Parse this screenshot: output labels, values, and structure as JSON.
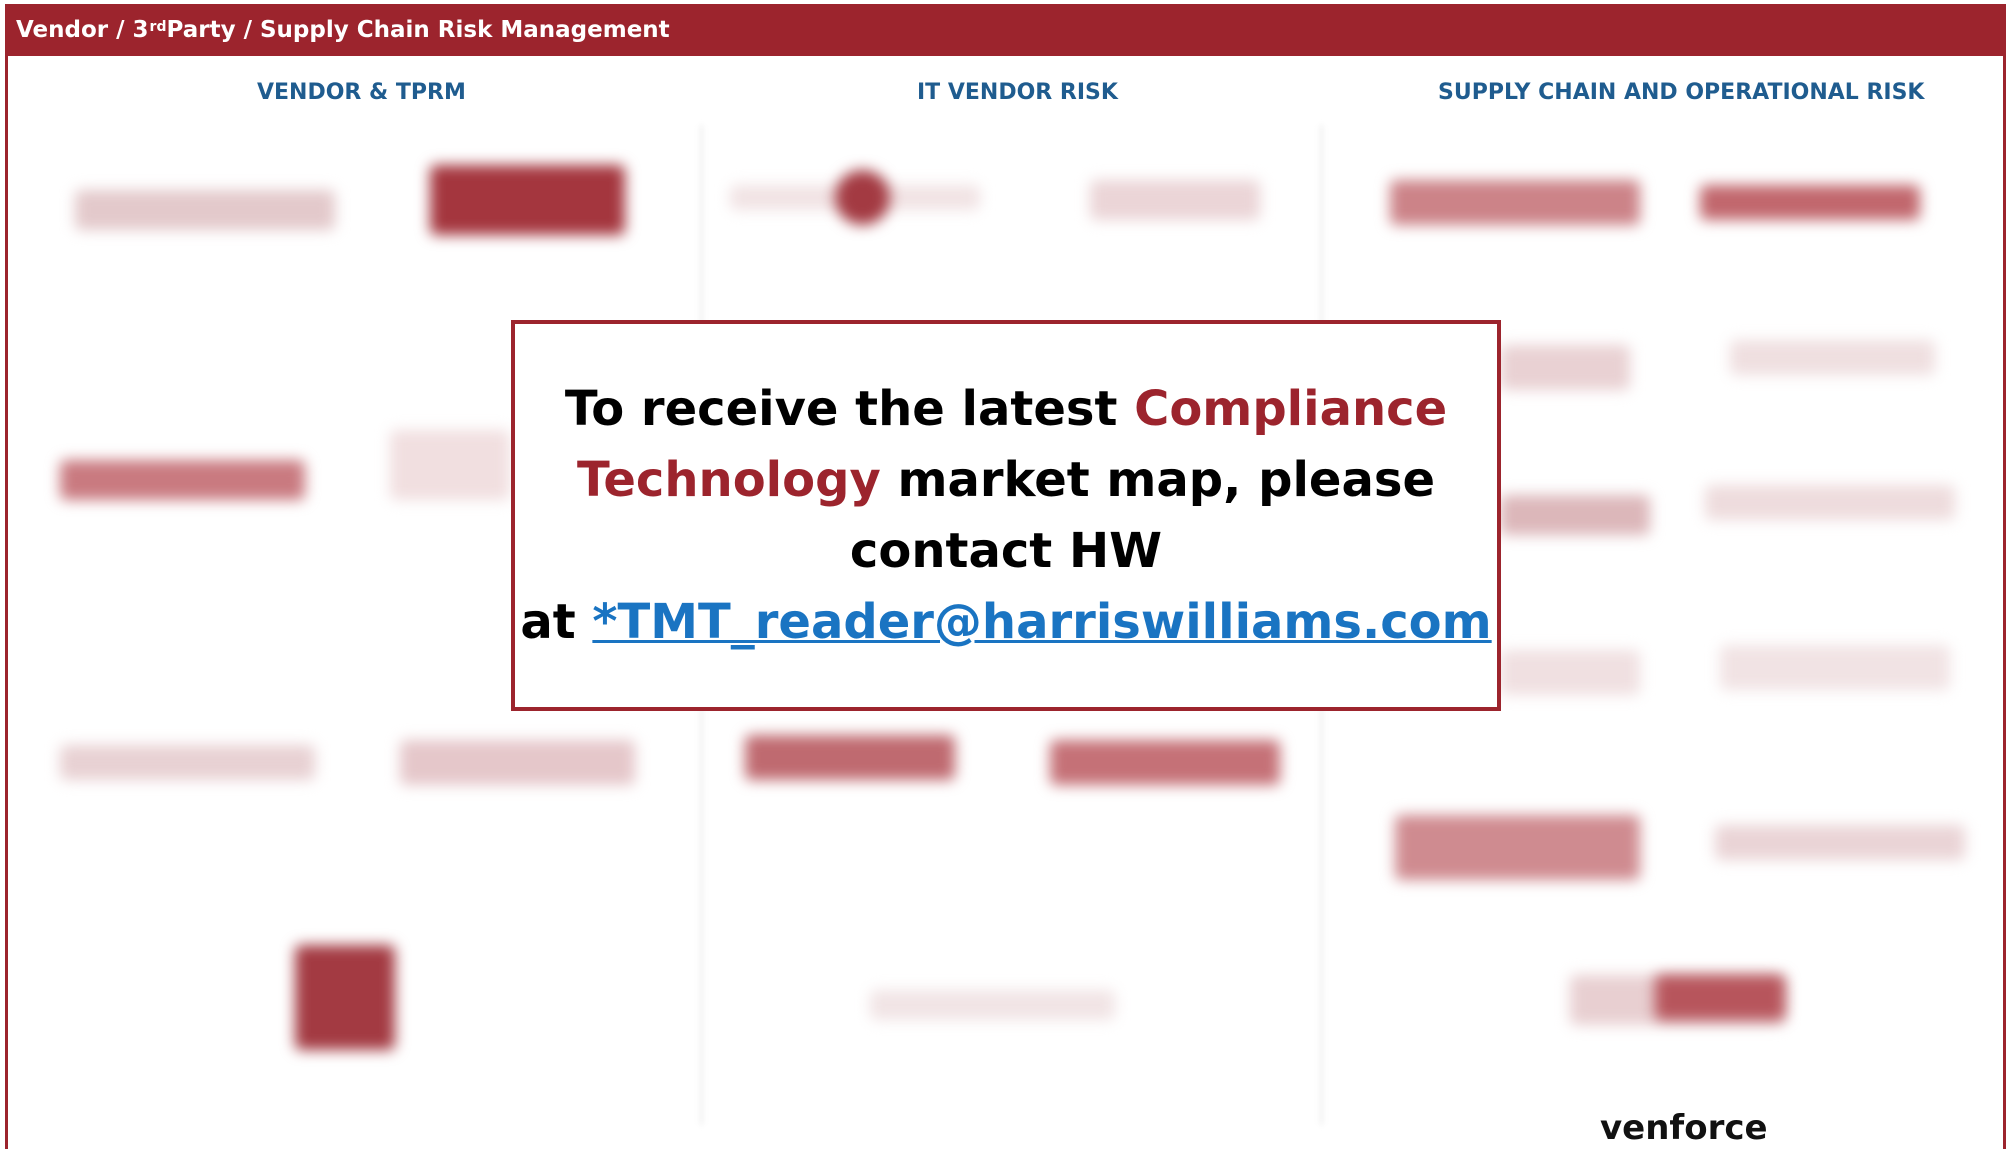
{
  "header": {
    "title_prefix": "Vendor / 3",
    "title_sup": "rd",
    "title_suffix": " Party / Supply Chain Risk Management"
  },
  "columns": [
    {
      "title": "VENDOR & TPRM"
    },
    {
      "title": "IT VENDOR RISK"
    },
    {
      "title": "SUPPLY CHAIN AND OPERATIONAL RISK"
    }
  ],
  "modal": {
    "line1_a": "To receive the latest ",
    "line1_b": "Compliance",
    "line2_a": "Technology",
    "line2_b": " market map, please",
    "line3": "contact HW",
    "line4_a": "at ",
    "email": "*TMT_reader@harriswilliams.com"
  },
  "footer_text": "venforce",
  "colors": {
    "brand": "#9c242d",
    "column_title": "#1f5c8f",
    "link": "#1a74c2"
  }
}
